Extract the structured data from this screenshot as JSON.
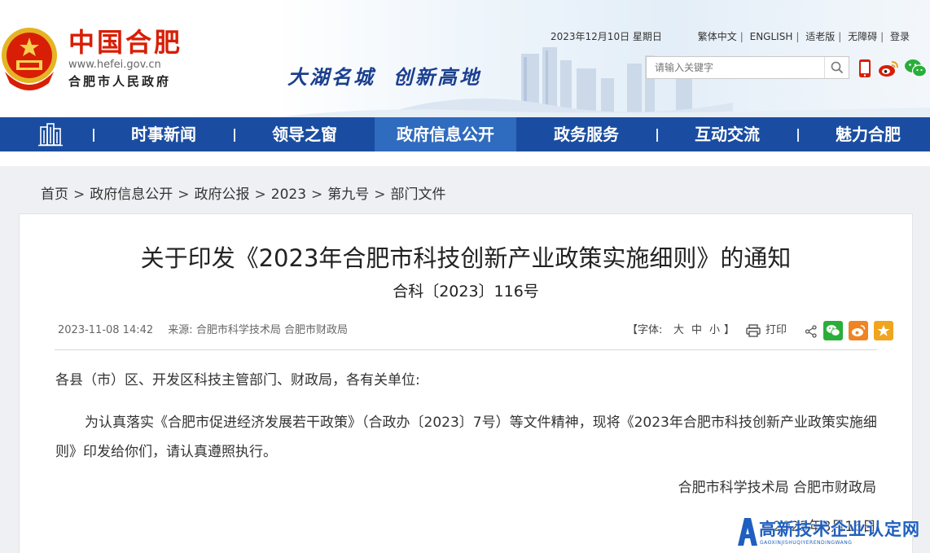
{
  "header": {
    "site_title": "中国合肥",
    "site_url": "www.hefei.gov.cn",
    "site_sub": "合肥市人民政府",
    "slogan_a": "大湖名城",
    "slogan_b": "创新高地",
    "date": "2023年12月10日 星期日",
    "links": [
      "繁体中文",
      "ENGLISH",
      "适老版",
      "无障碍",
      "登录"
    ],
    "search_placeholder": "请输入关键字",
    "colors": {
      "title_red": "#d81e06",
      "nav_blue": "#1a4da1",
      "nav_active": "#2f6bbf"
    }
  },
  "nav": {
    "items": [
      "时事新闻",
      "领导之窗",
      "政府信息公开",
      "政务服务",
      "互动交流",
      "魅力合肥"
    ],
    "active_index": 2
  },
  "breadcrumb": [
    "首页",
    "政府信息公开",
    "政府公报",
    "2023",
    "第九号",
    "部门文件"
  ],
  "article": {
    "title": "关于印发《2023年合肥市科技创新产业政策实施细则》的通知",
    "doc_number": "合科〔2023〕116号",
    "datetime": "2023-11-08 14:42",
    "source_label": "来源:",
    "source": "合肥市科学技术局 合肥市财政局",
    "font_label_open": "【字体:",
    "font_sizes": [
      "大",
      "中",
      "小"
    ],
    "font_label_close": "】",
    "print_label": "打印",
    "salutation": "各县（市）区、开发区科技主管部门、财政局，各有关单位:",
    "paragraph": "为认真落实《合肥市促进经济发展若干政策》（合政办〔2023〕7号）等文件精神，现将《2023年合肥市科技创新产业政策实施细则》印发给你们，请认真遵照执行。",
    "signer": "合肥市科学技术局  合肥市财政局",
    "sign_date": "2023年8月16日"
  },
  "watermark": {
    "text": "高新技术企业认定网",
    "sub": "GAOXINJISHUQIYERENDINGWANG"
  }
}
